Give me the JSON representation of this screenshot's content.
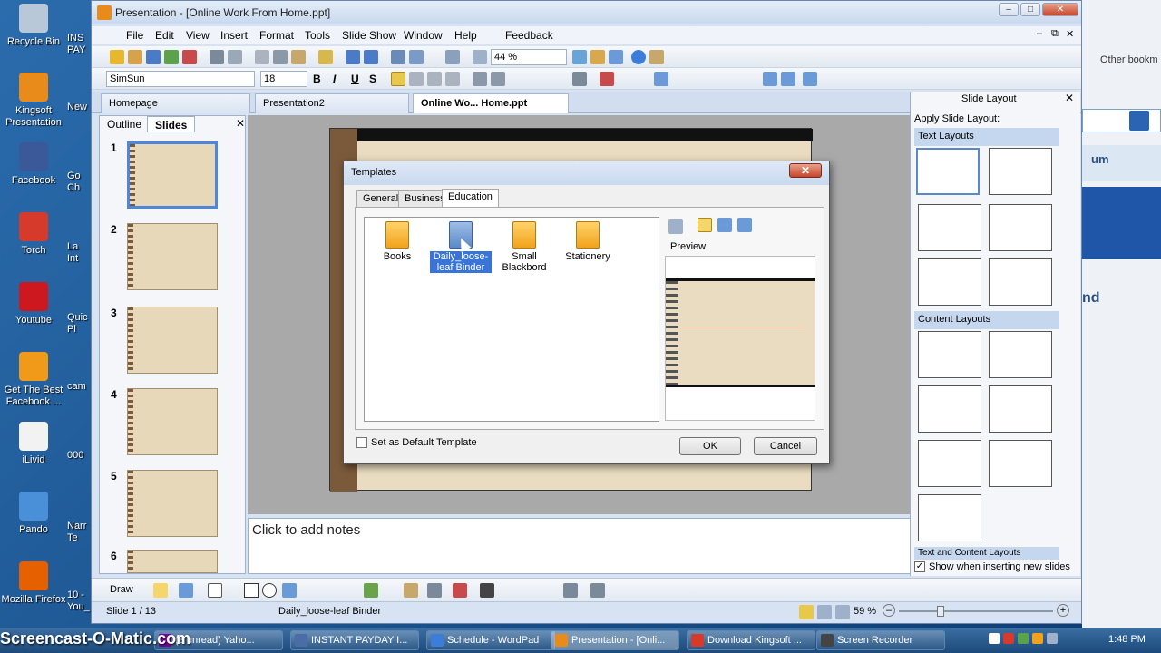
{
  "desktop": {
    "icons": [
      {
        "label": "Recycle Bin",
        "icon": "recycle-bin-icon",
        "color": "#b9c8d8"
      },
      {
        "label": "Kingsoft Presentation",
        "icon": "kingsoft-presentation-icon",
        "color": "#e88b1a"
      },
      {
        "label": "Facebook",
        "icon": "facebook-icon",
        "color": "#3b5998"
      },
      {
        "label": "Torch",
        "icon": "torch-icon",
        "color": "#d63a2a"
      },
      {
        "label": "Youtube",
        "icon": "youtube-icon",
        "color": "#cc181e"
      },
      {
        "label": "Get The Best Facebook ...",
        "icon": "shortcut-icon",
        "color": "#f19a1a"
      },
      {
        "label": "iLivid",
        "icon": "ilivid-icon",
        "color": "#f2f2f2"
      },
      {
        "label": "Pando",
        "icon": "pando-icon",
        "color": "#4a90d9"
      },
      {
        "label": "Mozilla Firefox",
        "icon": "firefox-icon",
        "color": "#e66000"
      }
    ],
    "partial_icons": [
      "INS PAY",
      "New",
      "Go Ch",
      "La Int",
      "Quic Pl",
      "cam",
      "000",
      "Narr Te",
      "10 - You_"
    ]
  },
  "window": {
    "title": "Presentation - [Online Work From Home.ppt]",
    "min": "–",
    "max": "□",
    "close": "✕"
  },
  "menu": [
    "File",
    "Edit",
    "View",
    "Insert",
    "Format",
    "Tools",
    "Slide Show",
    "Window",
    "Help",
    "Feedback"
  ],
  "toolbar": {
    "zoom": "44 %",
    "font": "SimSun",
    "font_size": "18",
    "bold": "B",
    "italic": "I",
    "underline": "U",
    "shadow": "S"
  },
  "doc_tabs": [
    {
      "label": "Homepage"
    },
    {
      "label": "Presentation2"
    },
    {
      "label": "Online Wo... Home.ppt"
    }
  ],
  "left_pane": {
    "tabs": [
      "Outline",
      "Slides"
    ],
    "slides": [
      "1",
      "2",
      "3",
      "4",
      "5",
      "6"
    ]
  },
  "notes_placeholder": "Click to add notes",
  "right_pane": {
    "title": "Slide Layout",
    "apply_label": "Apply Slide Layout:",
    "sections": [
      "Text Layouts",
      "Content Layouts",
      "Text and Content Layouts"
    ],
    "show_label": "Show when inserting new slides"
  },
  "dialog": {
    "title": "Templates",
    "tabs": [
      "General",
      "Business",
      "Education"
    ],
    "templates": [
      "Books",
      "Daily_loose-leaf Binder",
      "Small Blackbord",
      "Stationery"
    ],
    "preview_label": "Preview",
    "default_label": "Set as Default Template",
    "ok": "OK",
    "cancel": "Cancel"
  },
  "drawbar": {
    "draw": "Draw"
  },
  "status": {
    "slide": "Slide 1 / 13",
    "template": "Daily_loose-leaf Binder",
    "zoom": "59 %"
  },
  "taskbar": {
    "items": [
      {
        "label": "(3 unread) Yaho...",
        "color": "#7b0099"
      },
      {
        "label": "INSTANT PAYDAY I...",
        "color": "#4a6da7"
      },
      {
        "label": "Schedule - WordPad",
        "color": "#3b7dd8"
      },
      {
        "label": "Presentation - [Onli...",
        "color": "#e88b1a"
      },
      {
        "label": "Download Kingsoft ...",
        "color": "#d63a2a"
      },
      {
        "label": "Screen Recorder",
        "color": "#444"
      }
    ],
    "time": "1:48 PM"
  },
  "watermark": "Screencast-O-Matic.com",
  "browser": {
    "bookmarks": "Other bookm",
    "text1": "um",
    "text2": "nd"
  }
}
